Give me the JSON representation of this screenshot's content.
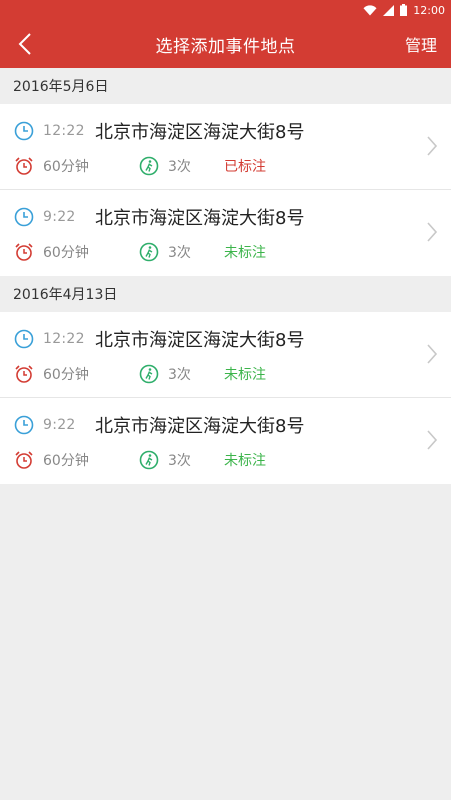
{
  "status_bar": {
    "time": "12:00"
  },
  "app_bar": {
    "title": "选择添加事件地点",
    "manage_label": "管理"
  },
  "colors": {
    "accent": "#d33c33",
    "clock": "#3aa0d8",
    "walk": "#2fae6b",
    "marked": "#d33c33",
    "unmarked": "#3cb44b"
  },
  "groups": [
    {
      "date": "2016年5月6日",
      "records": [
        {
          "time": "12:22",
          "place": "北京市海淀区海淀大街8号",
          "duration": "60分钟",
          "count": "3次",
          "status": "已标注"
        },
        {
          "time": "9:22",
          "place": "北京市海淀区海淀大街8号",
          "duration": "60分钟",
          "count": "3次",
          "status": "未标注"
        }
      ]
    },
    {
      "date": "2016年4月13日",
      "records": [
        {
          "time": "12:22",
          "place": "北京市海淀区海淀大街8号",
          "duration": "60分钟",
          "count": "3次",
          "status": "未标注"
        },
        {
          "time": "9:22",
          "place": "北京市海淀区海淀大街8号",
          "duration": "60分钟",
          "count": "3次",
          "status": "未标注"
        }
      ]
    }
  ]
}
